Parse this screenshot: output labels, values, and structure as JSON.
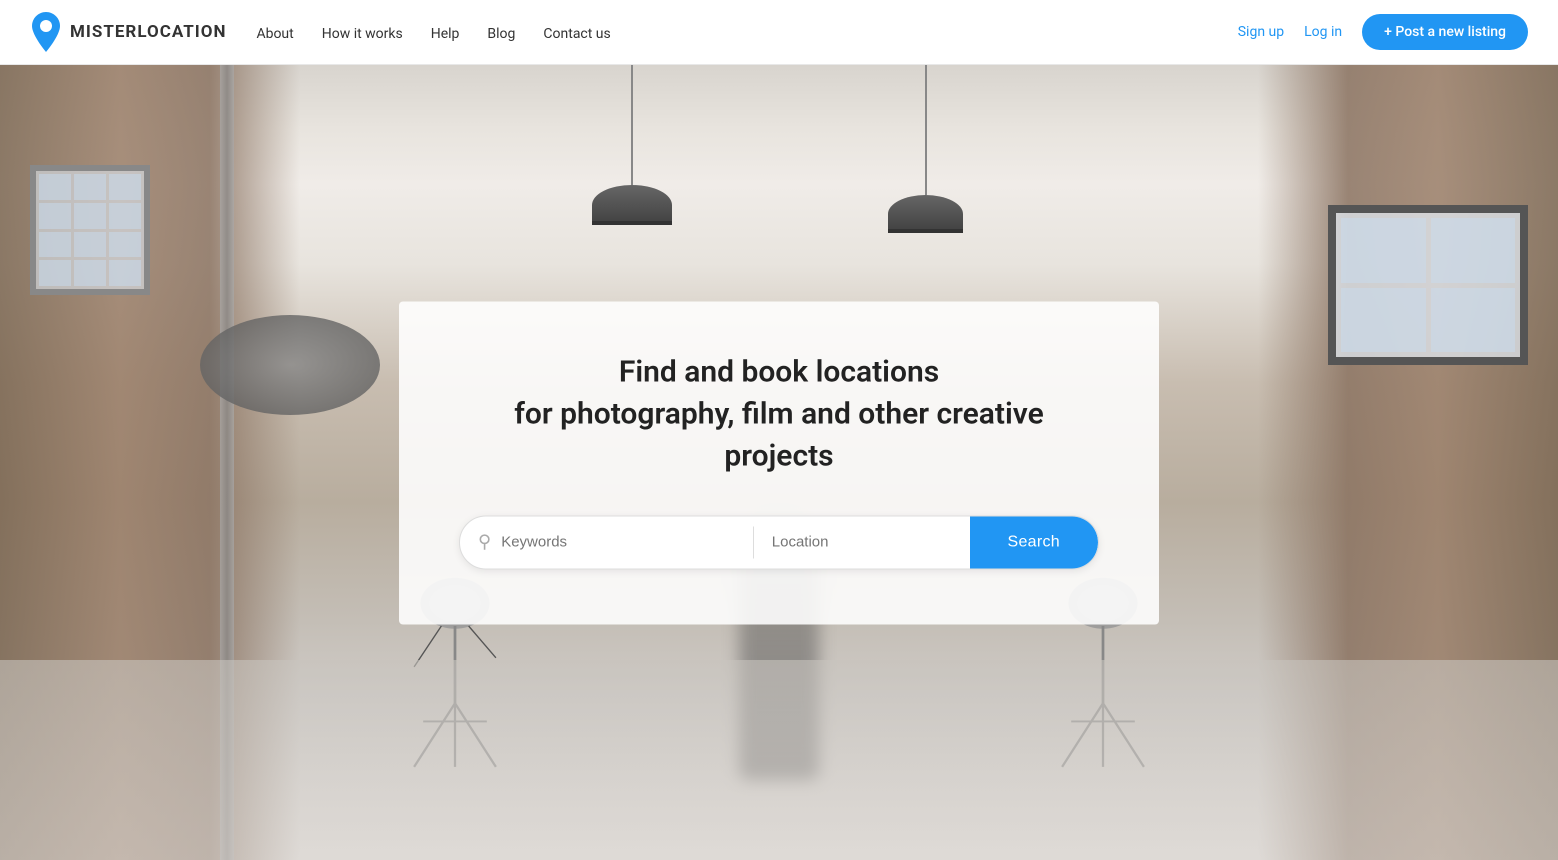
{
  "site": {
    "name_mister": "MISTER",
    "name_location": "LOCATION"
  },
  "navbar": {
    "about_label": "About",
    "how_it_works_label": "How it works",
    "help_label": "Help",
    "blog_label": "Blog",
    "contact_label": "Contact us",
    "sign_up_label": "Sign up",
    "log_in_label": "Log in",
    "post_listing_label": "+ Post a new listing"
  },
  "hero": {
    "title_line1": "Find and book locations",
    "title_line2": "for photography, film and other creative projects",
    "search_keywords_placeholder": "Keywords",
    "search_location_placeholder": "Location",
    "search_button_label": "Search"
  }
}
